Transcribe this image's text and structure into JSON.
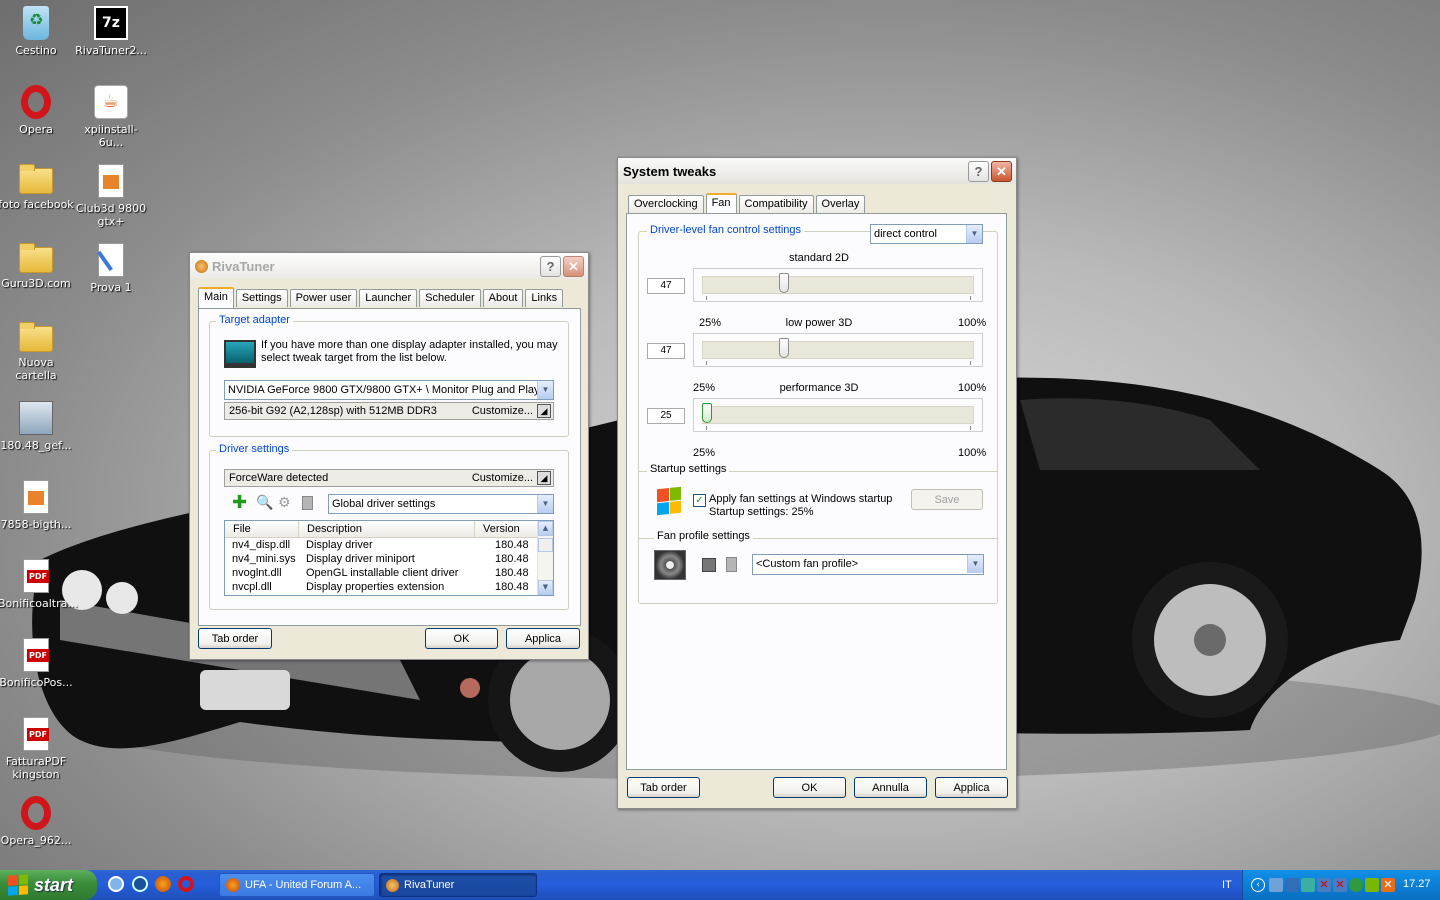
{
  "desktop": {
    "icons": [
      {
        "label": "Cestino",
        "icon": "recycle-bin-icon"
      },
      {
        "label": "RivaTuner2...",
        "icon": "7zip-archive-icon"
      },
      {
        "label": "Opera",
        "icon": "opera-icon"
      },
      {
        "label": "xpiinstall-6u...",
        "icon": "java-installer-icon"
      },
      {
        "label": "foto facebook",
        "icon": "folder-icon"
      },
      {
        "label": "Club3d 9800 gtx+",
        "icon": "image-file-icon"
      },
      {
        "label": "Guru3D.com",
        "icon": "folder-icon"
      },
      {
        "label": "Prova 1",
        "icon": "paint-file-icon"
      },
      {
        "label": "Nuova cartella",
        "icon": "folder-icon"
      },
      {
        "label": "180.48_gef...",
        "icon": "driver-installer-icon"
      },
      {
        "label": "7858-bigth...",
        "icon": "image-file-icon"
      },
      {
        "label": "Bonificoaltra...",
        "icon": "pdf-icon"
      },
      {
        "label": "BonificoPos...",
        "icon": "pdf-icon"
      },
      {
        "label": "FatturaPDF kingston",
        "icon": "pdf-icon"
      },
      {
        "label": "Opera_962...",
        "icon": "opera-icon"
      }
    ]
  },
  "rivatuner": {
    "title": "RivaTuner",
    "tabs": [
      "Main",
      "Settings",
      "Power user",
      "Launcher",
      "Scheduler",
      "About",
      "Links"
    ],
    "target_adapter": {
      "label": "Target adapter",
      "info": "If you have more than one display adapter installed, you may select tweak target from the list below.",
      "adapter": "NVIDIA GeForce 9800 GTX/9800 GTX+ \\ Monitor Plug and Play",
      "gpu_info": "256-bit G92 (A2,128sp) with 512MB DDR3",
      "customize": "Customize..."
    },
    "driver_settings": {
      "label": "Driver settings",
      "detected": "ForceWare detected",
      "customize": "Customize...",
      "profile": "Global driver settings",
      "columns": [
        "File",
        "Description",
        "Version"
      ],
      "rows": [
        [
          "nv4_disp.dll",
          "Display driver",
          "180.48"
        ],
        [
          "nv4_mini.sys",
          "Display driver miniport",
          "180.48"
        ],
        [
          "nvoglnt.dll",
          "OpenGL installable client driver",
          "180.48"
        ],
        [
          "nvcpl.dll",
          "Display properties extension",
          "180.48"
        ]
      ]
    },
    "buttons": {
      "tab_order": "Tab order",
      "ok": "OK",
      "apply": "Applica"
    }
  },
  "tweaks": {
    "title": "System tweaks",
    "tabs": [
      "Overclocking",
      "Fan",
      "Compatibility",
      "Overlay"
    ],
    "fan": {
      "group_label": "Driver-level fan control settings",
      "mode": "direct control",
      "sliders": [
        {
          "name": "standard 2D",
          "value": "47",
          "min": "25%",
          "max": "100%",
          "fraction": 0.29
        },
        {
          "name": "low power 3D",
          "value": "47",
          "min": "25%",
          "max": "100%",
          "fraction": 0.29
        },
        {
          "name": "performance 3D",
          "value": "25",
          "min": "25%",
          "max": "100%",
          "fraction": 0.0
        }
      ],
      "startup_label": "Startup settings",
      "apply_startup": "Apply fan settings at Windows startup",
      "startup_value": "Startup settings:  25%",
      "save": "Save",
      "profile_label": "Fan profile settings",
      "profile": "<Custom fan profile>"
    },
    "buttons": {
      "tab_order": "Tab order",
      "ok": "OK",
      "cancel": "Annulla",
      "apply": "Applica"
    }
  },
  "taskbar": {
    "start": "start",
    "tasks": [
      "UFA - United Forum A...",
      "RivaTuner"
    ],
    "language": "IT",
    "clock": "17.27"
  }
}
